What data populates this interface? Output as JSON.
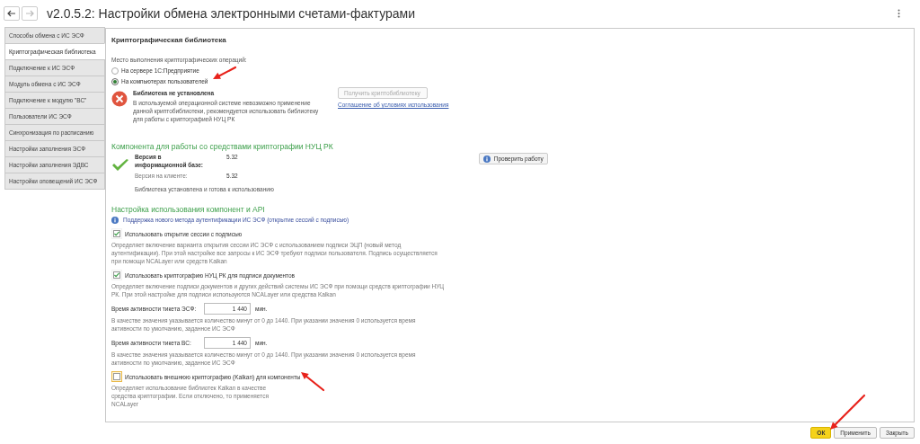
{
  "window": {
    "title": "v2.0.5.2: Настройки обмена электронными счетами-фактурами",
    "back_disabled": false,
    "forward_disabled": true
  },
  "sidebar": {
    "items": [
      {
        "label": "Способы обмена с ИС ЭСФ",
        "selected": false
      },
      {
        "label": "Криптографическая библиотека",
        "selected": true
      },
      {
        "label": "Подключение к ИС ЭСФ",
        "selected": false
      },
      {
        "label": "Модуль обмена с ИС ЭСФ",
        "selected": false
      },
      {
        "label": "Подключение к модулю \"ВС\"",
        "selected": false
      },
      {
        "label": "Пользователи ИС ЭСФ",
        "selected": false
      },
      {
        "label": "Синхронизация по расписанию",
        "selected": false
      },
      {
        "label": "Настройки заполнения ЭСФ",
        "selected": false
      },
      {
        "label": "Настройки заполнения ЭДВС",
        "selected": false
      },
      {
        "label": "Настройки оповещений ИС ЭСФ",
        "selected": false
      }
    ]
  },
  "panel": {
    "title": "Криптографическая библиотека",
    "operation_place": {
      "label": "Место выполнения криптографических операций:",
      "options": [
        {
          "label": "На сервере 1С:Предприятие",
          "selected": false
        },
        {
          "label": "На компьютерах пользователей",
          "selected": true
        }
      ]
    },
    "library_status": {
      "title": "Библиотека не установлена",
      "text": "В используемой операционной системе невозможно применение данной криптобиблиотеки, рекомендуется использовать библиотеку для работы с криптографией НУЦ РК",
      "button": "Получить криптобиблиотеку",
      "button_disabled": true,
      "link": "Соглашение об условиях использования"
    },
    "component": {
      "heading": "Компонента для работы со средствами криптографии НУЦ РК",
      "rows": [
        {
          "label": "Версия в информационной базе:",
          "value": "5.32"
        },
        {
          "label": "Версия на клиенте:",
          "value": "5.32"
        }
      ],
      "status": "Библиотека установлена и готова к использованию",
      "button": "Проверить работу"
    },
    "api": {
      "heading": "Настройка использования компонент и API",
      "info": "Поддержка нового метода аутентификации ИС ЭСФ (открытие сессий с подписью)",
      "items": [
        {
          "kind": "checkbox",
          "label": "Использовать открытие сессии с подписью",
          "checked": true,
          "focused": false,
          "description": "Определяет включение варианта открытия сессии ИС ЭСФ с использованием подписи ЭЦП (новый метод аутентификации). При этой настройке все запросы к ИС ЭСФ требуют подписи пользователя. Подпись осуществляется при помощи NCALayer или средств Kalkan"
        },
        {
          "kind": "checkbox",
          "label": "Использовать криптографию НУЦ РК для подписи документов",
          "checked": true,
          "focused": false,
          "description": "Определяет включение подписи документов и других действий системы ИС ЭСФ при помощи средств криптографии НУЦ РК. При этой настройке для подписи используются NCALayer или средства Kalkan"
        },
        {
          "kind": "field",
          "label": "Время активности тикета ЭСФ:",
          "value": "1 440",
          "unit": "мин.",
          "description": "В качестве значения указывается количество минут от 0 до 1440. При указании значения 0 используется время активности по умолчанию, заданное ИС ЭСФ"
        },
        {
          "kind": "field",
          "label": "Время активности тикета ВС:",
          "value": "1 440",
          "unit": "мин.",
          "description": "В качестве значения указывается количество минут от 0 до 1440. При указании значения 0 используется время активности по умолчанию, заданное ИС ЭСФ"
        },
        {
          "kind": "checkbox",
          "label": "Использовать внешнюю криптографию (Kalkan) для компоненты",
          "checked": false,
          "focused": true,
          "description": "Определяет использование библиотек Kalkan в качестве средства криптографии. Если отключено, то применяется NCALayer"
        }
      ]
    }
  },
  "buttons": [
    {
      "label": "ОК",
      "default": true
    },
    {
      "label": "Применить",
      "default": false
    },
    {
      "label": "Закрыть",
      "default": false
    }
  ]
}
